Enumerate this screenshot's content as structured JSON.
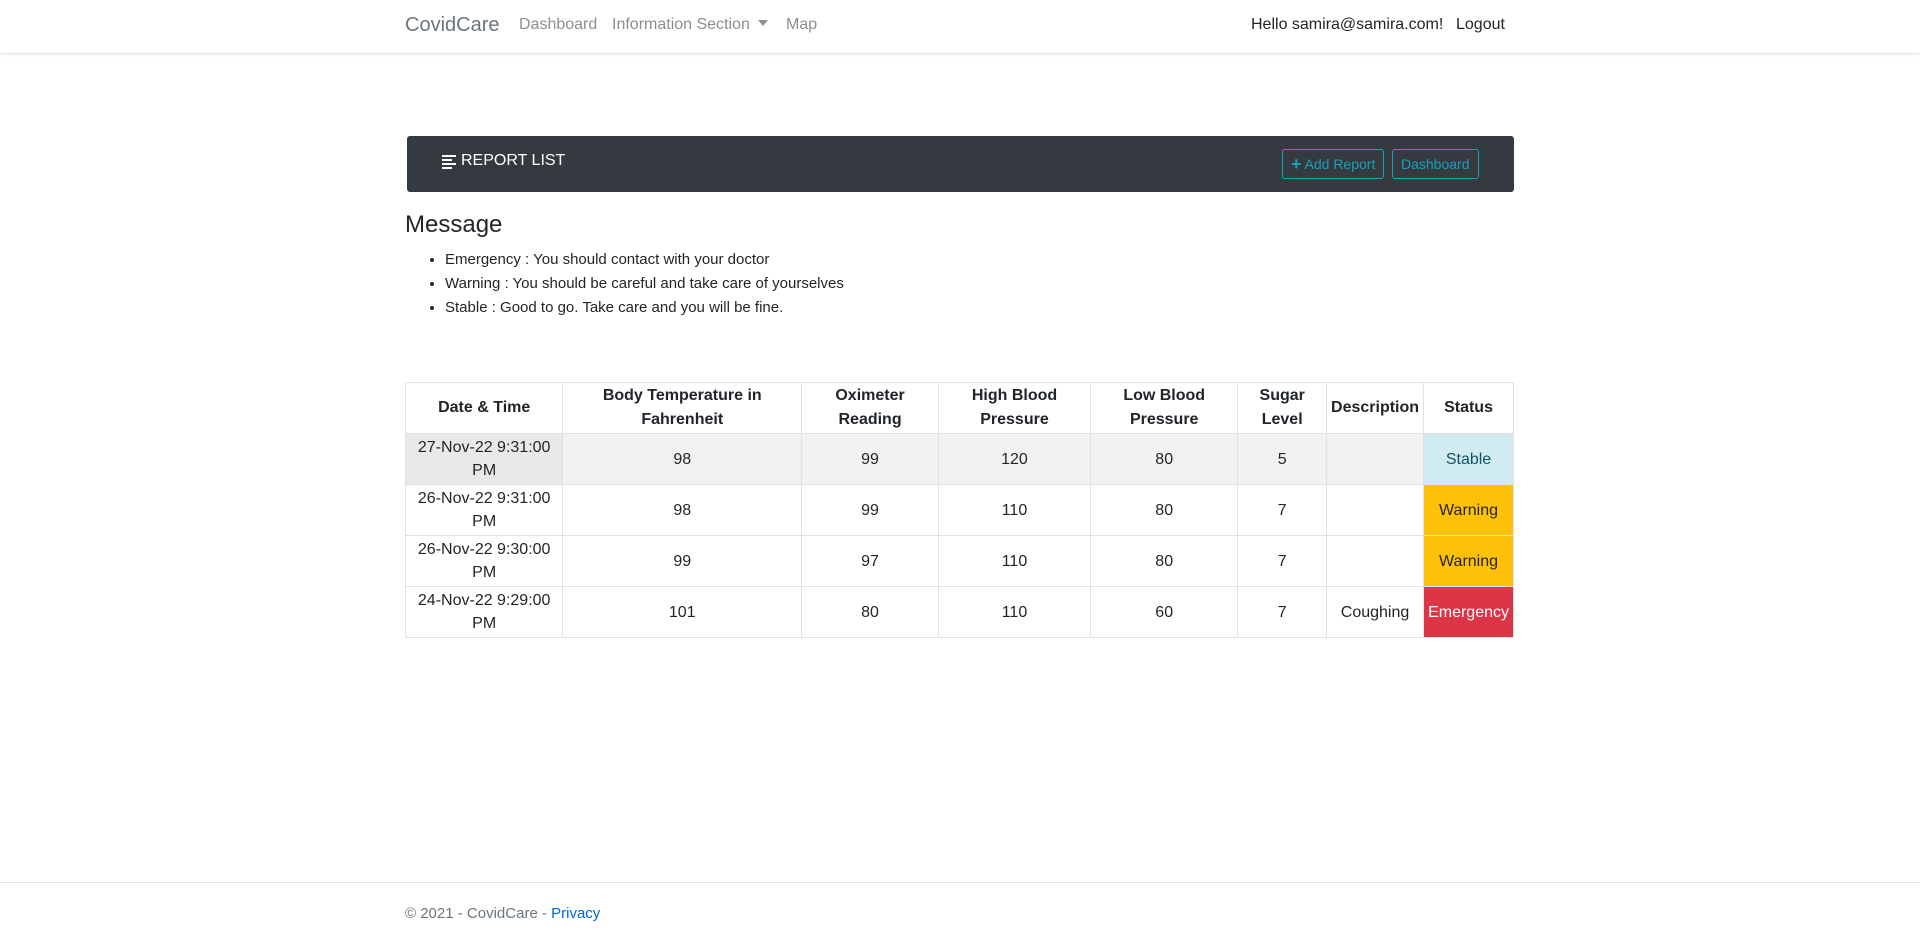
{
  "navbar": {
    "brand": "CovidCare",
    "links": [
      "Dashboard",
      "Information Section",
      "Map"
    ],
    "greeting": "Hello samira@samira.com!",
    "logout": "Logout"
  },
  "report_bar": {
    "title": "REPORT LIST",
    "icon": "list-icon",
    "add_report": "Add Report",
    "dashboard": "Dashboard",
    "accent_color": "#17a2b8",
    "bar_color": "#343a40"
  },
  "message": {
    "title": "Message",
    "items": [
      "Emergency : You should contact with your doctor",
      "Warning : You should be careful and take care of yourselves",
      "Stable : Good to go. Take care and you will be fine."
    ]
  },
  "table": {
    "headers": [
      "Date & Time",
      "Body Temperature in Fahrenheit",
      "Oximeter Reading",
      "High Blood Pressure",
      "Low Blood Pressure",
      "Sugar Level",
      "Description",
      "Status"
    ],
    "rows": [
      [
        "27-Nov-22 9:31:00 PM",
        "98",
        "99",
        "120",
        "80",
        "5",
        "",
        "Stable"
      ],
      [
        "26-Nov-22 9:31:00 PM",
        "98",
        "99",
        "110",
        "80",
        "7",
        "",
        "Warning"
      ],
      [
        "26-Nov-22 9:30:00 PM",
        "99",
        "97",
        "110",
        "80",
        "7",
        "",
        "Warning"
      ],
      [
        "24-Nov-22 9:29:00 PM",
        "101",
        "80",
        "110",
        "60",
        "7",
        "Coughing",
        "Emergency"
      ]
    ],
    "status_colors": {
      "Stable": "#d1ecf1",
      "Warning": "#ffc107",
      "Emergency": "#dc3545"
    }
  },
  "footer": {
    "text": "© 2021 - CovidCare - ",
    "privacy": "Privacy"
  }
}
